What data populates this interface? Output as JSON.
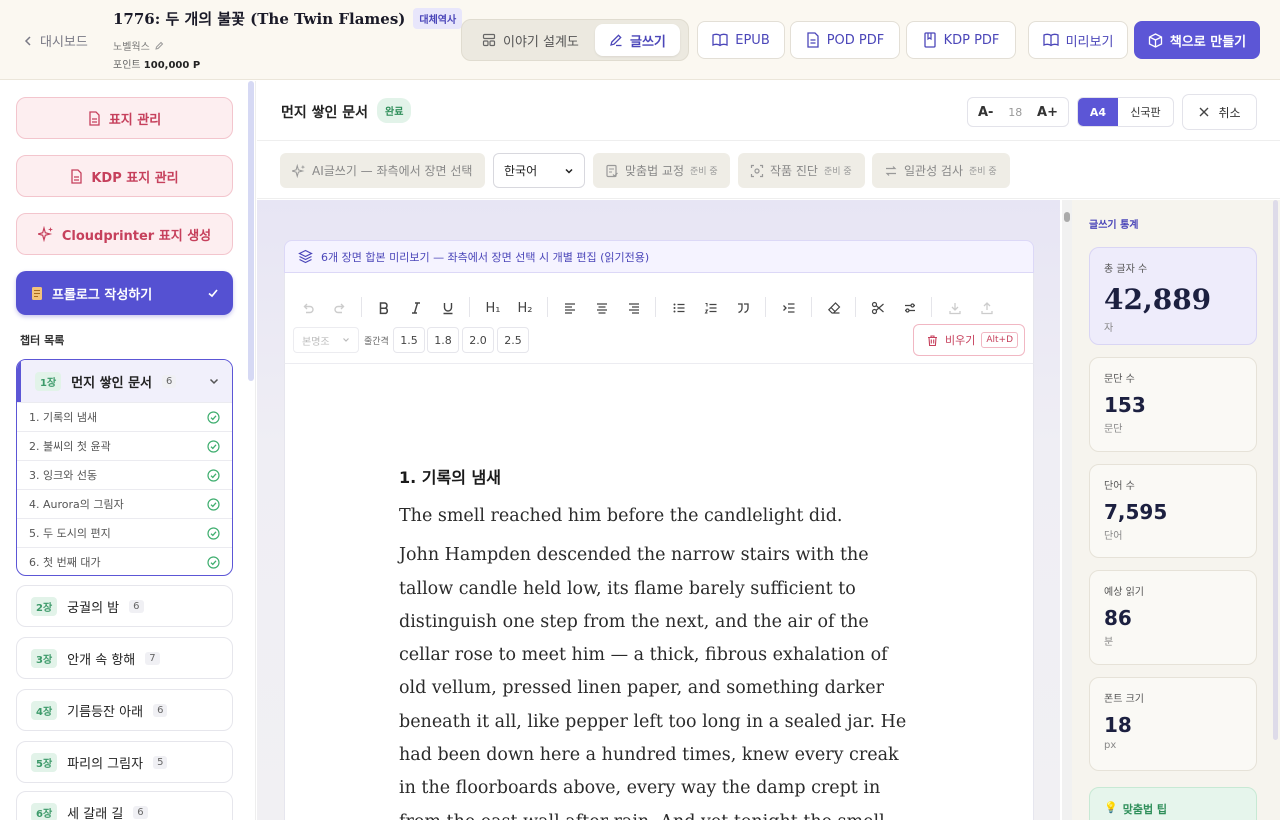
{
  "header": {
    "back_label": "대시보드",
    "book_title": "1776: 두 개의 불꽃 (The Twin Flames)",
    "genre": "대체역사",
    "author": "노벨웍스",
    "points_label": "포인트",
    "points_value": "100,000 P",
    "tabs": [
      {
        "label": "이야기 설계도",
        "icon": "layout-icon",
        "active": false
      },
      {
        "label": "글쓰기",
        "icon": "pen-icon",
        "active": true
      }
    ],
    "actions": [
      {
        "label": "EPUB",
        "icon": "book-open-icon"
      },
      {
        "label": "POD PDF",
        "icon": "file-icon"
      },
      {
        "label": "KDP PDF",
        "icon": "book-icon"
      },
      {
        "label": "미리보기",
        "icon": "book-open-icon"
      },
      {
        "label": "책으로 만들기",
        "icon": "package-icon"
      }
    ]
  },
  "sidebar": {
    "cover_manage": "표지 관리",
    "kdp_cover_manage": "KDP 표지 관리",
    "cloudprinter_cover": "Cloudprinter 표지 생성",
    "prologue": "프롤로그 작성하기",
    "chapter_heading": "챕터 목록",
    "open_chapter": {
      "no": "1장",
      "title": "먼지 쌓인 문서",
      "count": "6",
      "scenes": [
        "1. 기록의 냄새",
        "2. 불씨의 첫 윤곽",
        "3. 잉크와 선동",
        "4. Aurora의 그림자",
        "5. 두 도시의 편지",
        "6. 첫 번째 대가"
      ]
    },
    "chapters": [
      {
        "no": "2장",
        "title": "궁궐의 밤",
        "count": "6"
      },
      {
        "no": "3장",
        "title": "안개 속 항해",
        "count": "7"
      },
      {
        "no": "4장",
        "title": "기름등잔 아래",
        "count": "6"
      },
      {
        "no": "5장",
        "title": "파리의 그림자",
        "count": "5"
      },
      {
        "no": "6장",
        "title": "세 갈래 길",
        "count": "6"
      }
    ]
  },
  "editor": {
    "scene_title": "먼지 쌓인 문서",
    "status": "완료",
    "font_minus": "A-",
    "font_size": "18",
    "font_plus": "A+",
    "page_a4": "A4",
    "page_new": "신국판",
    "cancel": "취소",
    "tools": {
      "ai_write": "AI글쓰기 — 좌측에서 장면 선택",
      "language": "한국어",
      "spell_check": "맞춤법 교정",
      "diagnose": "작품 진단",
      "consistency": "일관성 검사",
      "preparing": "준비 중"
    },
    "preview_banner": "6개 장면 합본 미리보기 — 좌측에서 장면 선택 시 개별 편집 (읽기전용)",
    "toolbar": {
      "font_family": "본명조",
      "spacing_label": "줄간격",
      "spacings": [
        "1.5",
        "1.8",
        "2.0",
        "2.5"
      ],
      "clear": "비우기",
      "clear_shortcut": "Alt+D",
      "h1": "H₁",
      "h2": "H₂"
    },
    "page": {
      "heading": "1. 기록의 냄새",
      "paragraphs": [
        "The smell reached him before the candlelight did.",
        "John Hampden descended the narrow stairs with the tallow candle held low, its flame barely sufficient to distinguish one step from the next, and the air of the cellar rose to meet him — a thick, fibrous exhalation of old vellum, pressed linen paper, and something darker beneath it all, like pepper left too long in a sealed jar. He had been down here a hundred times, knew every creak in the floorboards above, every way the damp crept in from the east wall after rain. And yet tonight the smell"
      ]
    }
  },
  "stats": {
    "title": "글쓰기 통계",
    "cards": [
      {
        "label": "총 글자 수",
        "value": "42,889",
        "unit": "자"
      },
      {
        "label": "문단 수",
        "value": "153",
        "unit": "문단"
      },
      {
        "label": "단어 수",
        "value": "7,595",
        "unit": "단어"
      },
      {
        "label": "예상 읽기",
        "value": "86",
        "unit": "분"
      },
      {
        "label": "폰트 크기",
        "value": "18",
        "unit": "px"
      }
    ],
    "tip": "맞춤법 팁"
  },
  "colors": {
    "accent": "#5c56d6",
    "pink": "#c6405c",
    "green": "#2f8f5a",
    "header_bg": "#fbf8f1"
  }
}
